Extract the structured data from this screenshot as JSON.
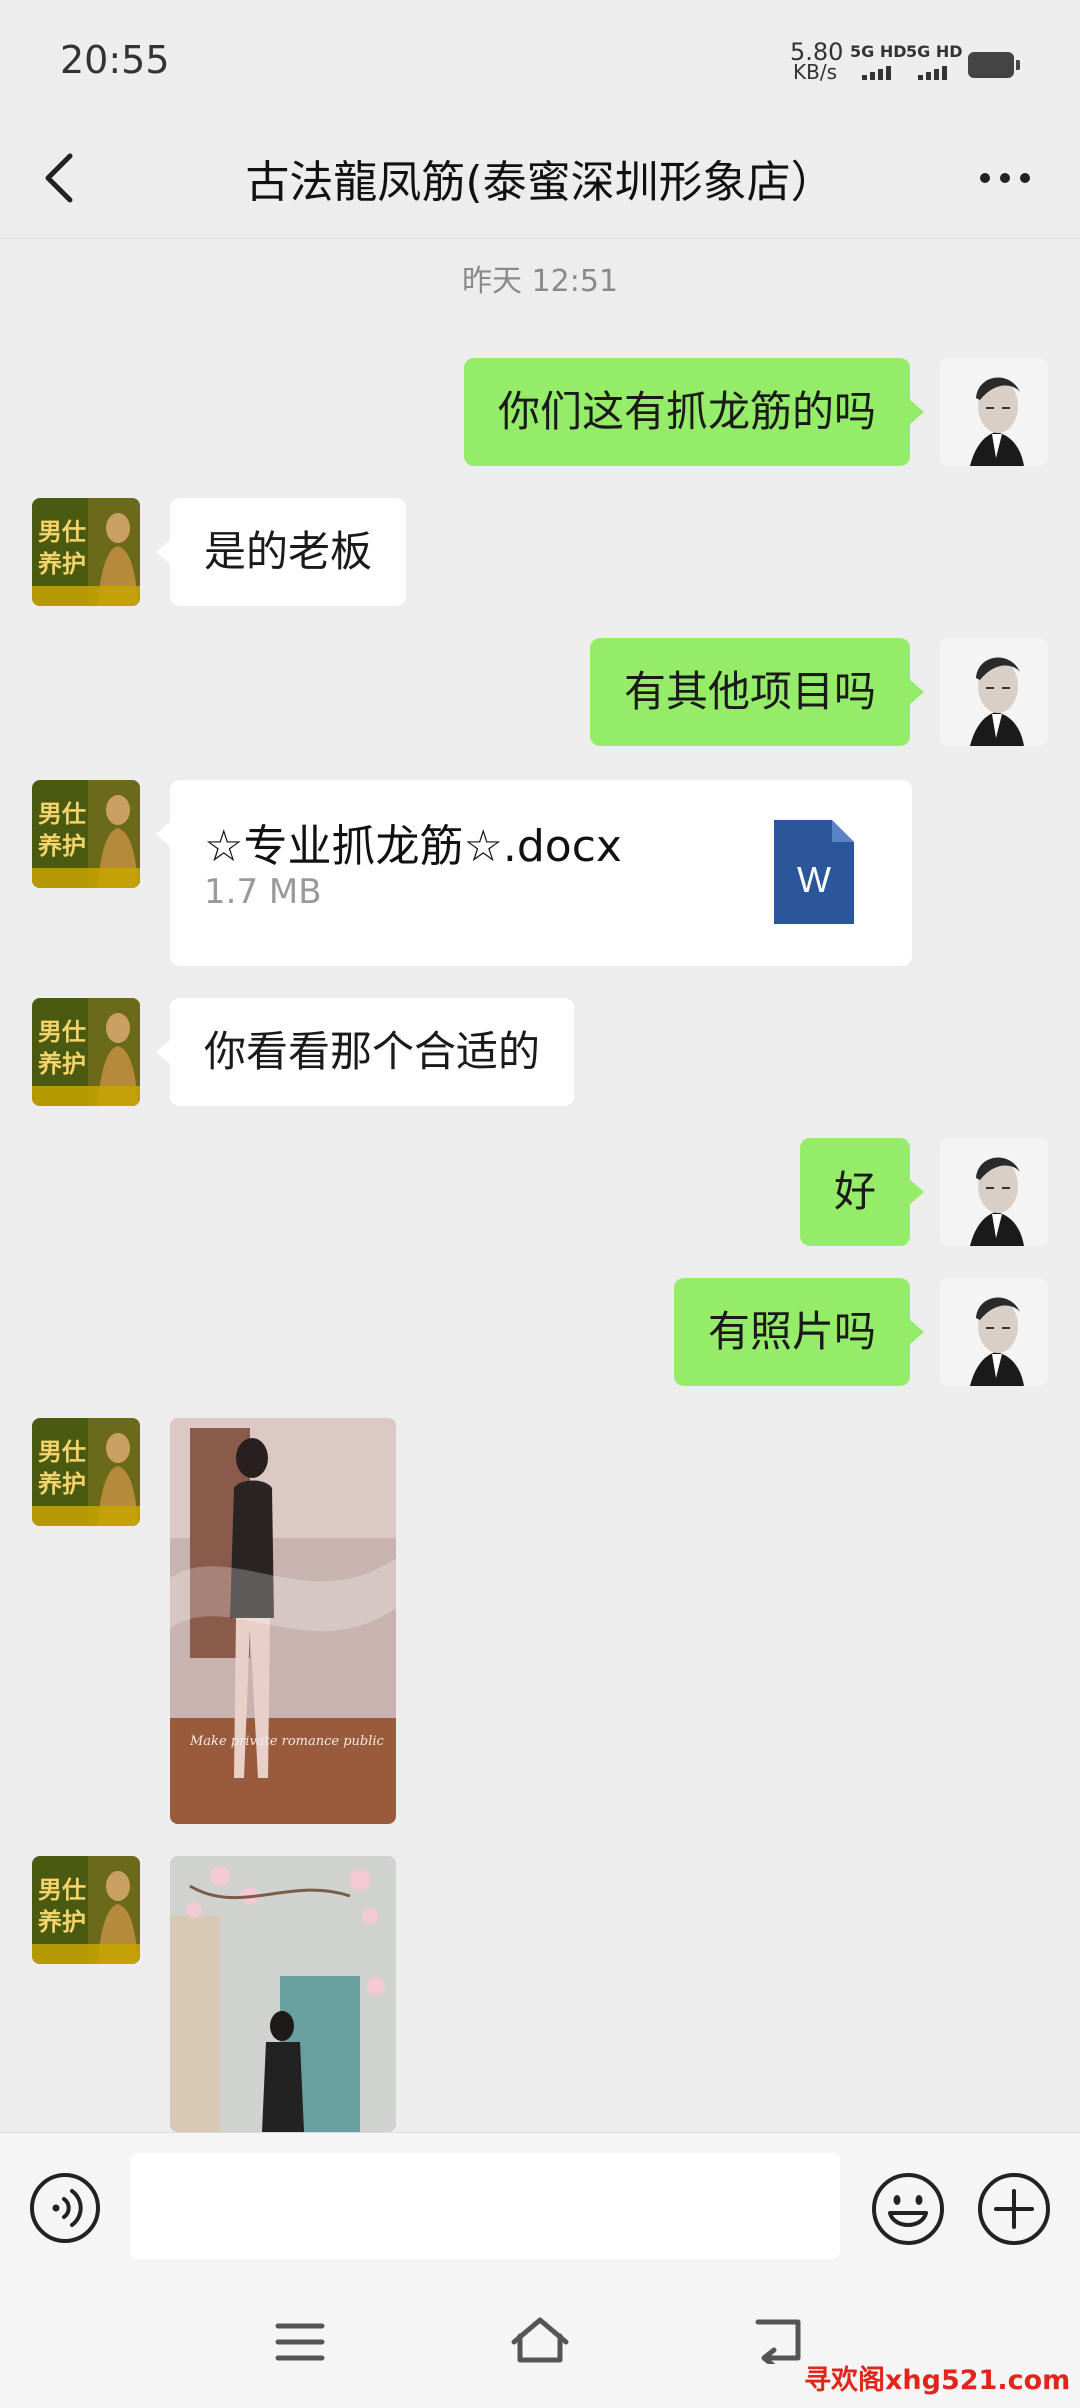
{
  "status_bar": {
    "time": "20:55",
    "net_speed": "5.80",
    "net_unit": "KB/s",
    "sim1": "5G HD",
    "sim2": "5G HD"
  },
  "header": {
    "title": "古法龍凤筋(泰蜜深圳形象店）"
  },
  "chat": {
    "timestamp": "昨天 12:51",
    "messages": [
      {
        "from": "me",
        "text": "你们这有抓龙筋的吗"
      },
      {
        "from": "them",
        "text": "是的老板"
      },
      {
        "from": "me",
        "text": "有其他项目吗"
      },
      {
        "from": "them",
        "type": "file",
        "file_name": "☆专业抓龙筋☆.docx",
        "file_size": "1.7 MB",
        "file_icon": "word-doc-icon"
      },
      {
        "from": "them",
        "text": "你看看那个合适的"
      },
      {
        "from": "me",
        "text": "好"
      },
      {
        "from": "me",
        "text": "有照片吗"
      },
      {
        "from": "them",
        "type": "image",
        "caption": "Make private romance public"
      },
      {
        "from": "them",
        "type": "image"
      }
    ],
    "them_avatar_text": [
      "男仕",
      "养护"
    ]
  },
  "input_bar": {
    "value": "",
    "placeholder": ""
  },
  "watermark": "寻欢阁xhg521.com",
  "colors": {
    "background": "#ededed",
    "my_bubble": "#95ec69",
    "their_bubble": "#ffffff",
    "word_blue": "#2b579a"
  }
}
